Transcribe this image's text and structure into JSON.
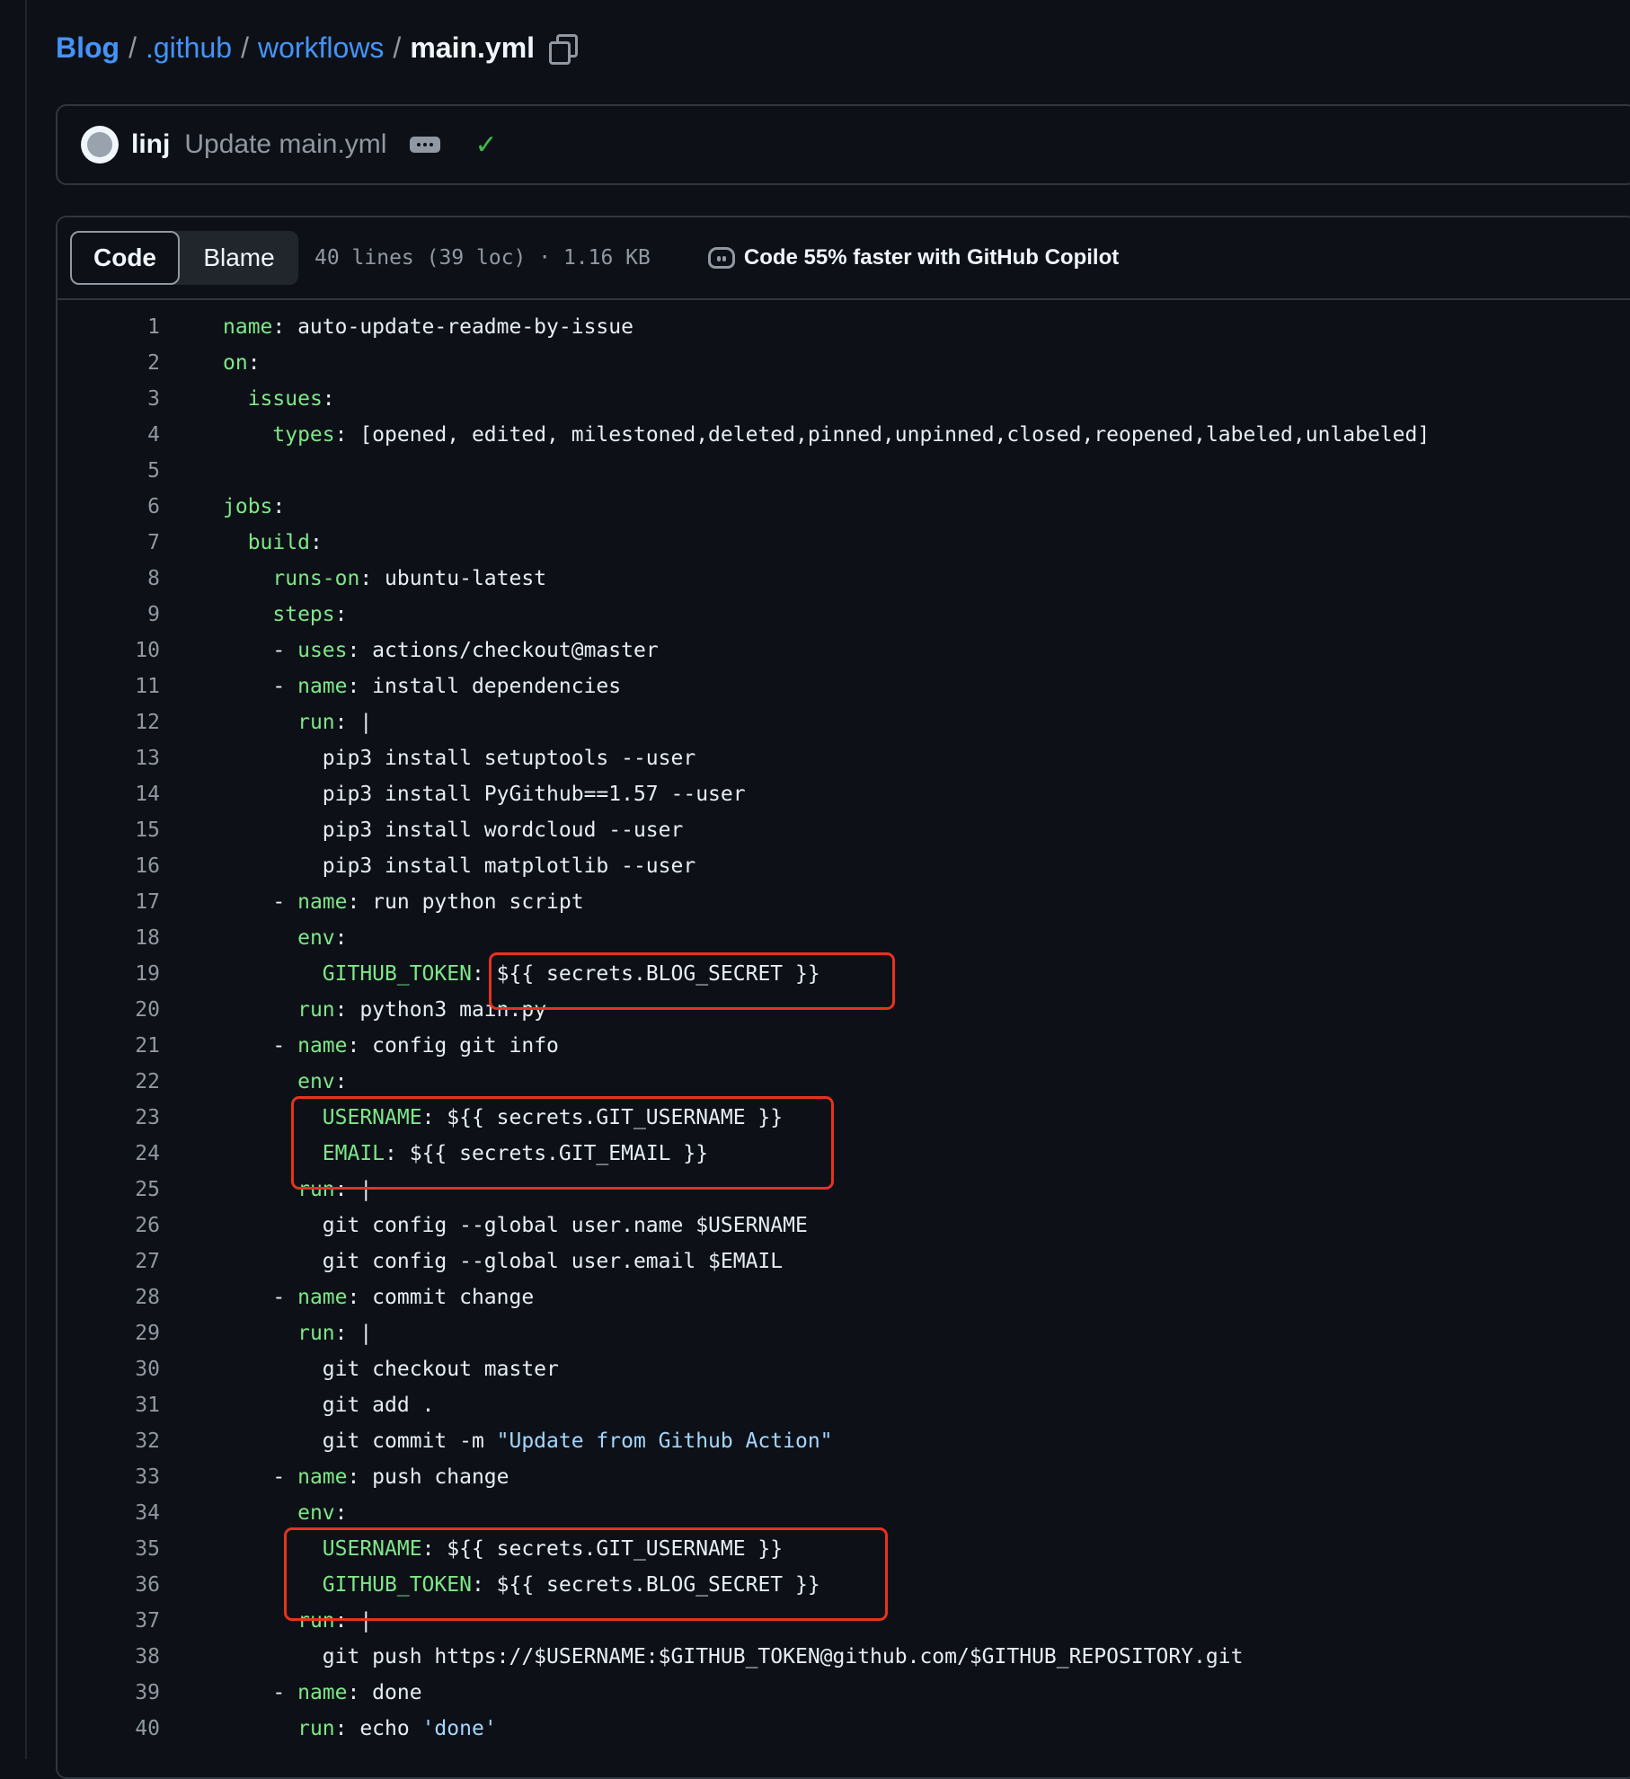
{
  "breadcrumb": {
    "repo": "Blog",
    "dir1": ".github",
    "dir2": "workflows",
    "file": "main.yml",
    "separator": "/"
  },
  "commit": {
    "author": "linj",
    "message": "Update main.yml",
    "status": "success"
  },
  "file_header": {
    "tabs": [
      "Code",
      "Blame"
    ],
    "active_tab": "Code",
    "info": "40 lines (39 loc) · 1.16 KB",
    "copilot": "Code 55% faster with GitHub Copilot"
  },
  "code_lines": [
    [
      [
        "key",
        "name"
      ],
      [
        "txt",
        ": auto-update-readme-by-issue"
      ]
    ],
    [
      [
        "key",
        "on"
      ],
      [
        "txt",
        ":"
      ]
    ],
    [
      [
        "txt",
        "  "
      ],
      [
        "key",
        "issues"
      ],
      [
        "txt",
        ":"
      ]
    ],
    [
      [
        "txt",
        "    "
      ],
      [
        "key",
        "types"
      ],
      [
        "txt",
        ": [opened, edited, milestoned,deleted,pinned,unpinned,closed,reopened,labeled,unlabeled]"
      ]
    ],
    [],
    [
      [
        "key",
        "jobs"
      ],
      [
        "txt",
        ":"
      ]
    ],
    [
      [
        "txt",
        "  "
      ],
      [
        "key",
        "build"
      ],
      [
        "txt",
        ":"
      ]
    ],
    [
      [
        "txt",
        "    "
      ],
      [
        "key",
        "runs-on"
      ],
      [
        "txt",
        ": ubuntu-latest"
      ]
    ],
    [
      [
        "txt",
        "    "
      ],
      [
        "key",
        "steps"
      ],
      [
        "txt",
        ":"
      ]
    ],
    [
      [
        "txt",
        "    - "
      ],
      [
        "key",
        "uses"
      ],
      [
        "txt",
        ": actions/checkout@master"
      ]
    ],
    [
      [
        "txt",
        "    - "
      ],
      [
        "key",
        "name"
      ],
      [
        "txt",
        ": install dependencies"
      ]
    ],
    [
      [
        "txt",
        "      "
      ],
      [
        "key",
        "run"
      ],
      [
        "txt",
        ": |"
      ]
    ],
    [
      [
        "txt",
        "        pip3 install setuptools --user"
      ]
    ],
    [
      [
        "txt",
        "        pip3 install PyGithub==1.57 --user"
      ]
    ],
    [
      [
        "txt",
        "        pip3 install wordcloud --user"
      ]
    ],
    [
      [
        "txt",
        "        pip3 install matplotlib --user"
      ]
    ],
    [
      [
        "txt",
        "    - "
      ],
      [
        "key",
        "name"
      ],
      [
        "txt",
        ": run python script"
      ]
    ],
    [
      [
        "txt",
        "      "
      ],
      [
        "key",
        "env"
      ],
      [
        "txt",
        ":"
      ]
    ],
    [
      [
        "txt",
        "        "
      ],
      [
        "key",
        "GITHUB_TOKEN"
      ],
      [
        "txt",
        ": ${{ secrets.BLOG_SECRET }}"
      ]
    ],
    [
      [
        "txt",
        "      "
      ],
      [
        "key",
        "run"
      ],
      [
        "txt",
        ": python3 main.py"
      ]
    ],
    [
      [
        "txt",
        "    - "
      ],
      [
        "key",
        "name"
      ],
      [
        "txt",
        ": config git info"
      ]
    ],
    [
      [
        "txt",
        "      "
      ],
      [
        "key",
        "env"
      ],
      [
        "txt",
        ":"
      ]
    ],
    [
      [
        "txt",
        "        "
      ],
      [
        "key",
        "USERNAME"
      ],
      [
        "txt",
        ": ${{ secrets.GIT_USERNAME }}"
      ]
    ],
    [
      [
        "txt",
        "        "
      ],
      [
        "key",
        "EMAIL"
      ],
      [
        "txt",
        ": ${{ secrets.GIT_EMAIL }}"
      ]
    ],
    [
      [
        "txt",
        "      "
      ],
      [
        "key",
        "run"
      ],
      [
        "txt",
        ": |"
      ]
    ],
    [
      [
        "txt",
        "        git config --global user.name $USERNAME"
      ]
    ],
    [
      [
        "txt",
        "        git config --global user.email $EMAIL"
      ]
    ],
    [
      [
        "txt",
        "    - "
      ],
      [
        "key",
        "name"
      ],
      [
        "txt",
        ": commit change"
      ]
    ],
    [
      [
        "txt",
        "      "
      ],
      [
        "key",
        "run"
      ],
      [
        "txt",
        ": |"
      ]
    ],
    [
      [
        "txt",
        "        git checkout master"
      ]
    ],
    [
      [
        "txt",
        "        git add ."
      ]
    ],
    [
      [
        "txt",
        "        git commit -m "
      ],
      [
        "str",
        "\"Update from Github Action\""
      ]
    ],
    [
      [
        "txt",
        "    - "
      ],
      [
        "key",
        "name"
      ],
      [
        "txt",
        ": push change"
      ]
    ],
    [
      [
        "txt",
        "      "
      ],
      [
        "key",
        "env"
      ],
      [
        "txt",
        ":"
      ]
    ],
    [
      [
        "txt",
        "        "
      ],
      [
        "key",
        "USERNAME"
      ],
      [
        "txt",
        ": ${{ secrets.GIT_USERNAME }}"
      ]
    ],
    [
      [
        "txt",
        "        "
      ],
      [
        "key",
        "GITHUB_TOKEN"
      ],
      [
        "txt",
        ": ${{ secrets.BLOG_SECRET }}"
      ]
    ],
    [
      [
        "txt",
        "      "
      ],
      [
        "key",
        "run"
      ],
      [
        "txt",
        ": |"
      ]
    ],
    [
      [
        "txt",
        "        git push https://$USERNAME:$GITHUB_TOKEN@github.com/$GITHUB_REPOSITORY.git"
      ]
    ],
    [
      [
        "txt",
        "    - "
      ],
      [
        "key",
        "name"
      ],
      [
        "txt",
        ": done"
      ]
    ],
    [
      [
        "txt",
        "      "
      ],
      [
        "key",
        "run"
      ],
      [
        "txt",
        ": echo "
      ],
      [
        "str",
        "'done'"
      ]
    ]
  ],
  "highlights": [
    {
      "lines": [
        19,
        19
      ]
    },
    {
      "lines": [
        23,
        24
      ]
    },
    {
      "lines": [
        35,
        36
      ]
    }
  ],
  "colors": {
    "background": "#0d1117",
    "link": "#4493f8",
    "yaml_key": "#7ee787",
    "string": "#a5d6ff",
    "annotation": "#e8321e",
    "success": "#3fb950"
  }
}
